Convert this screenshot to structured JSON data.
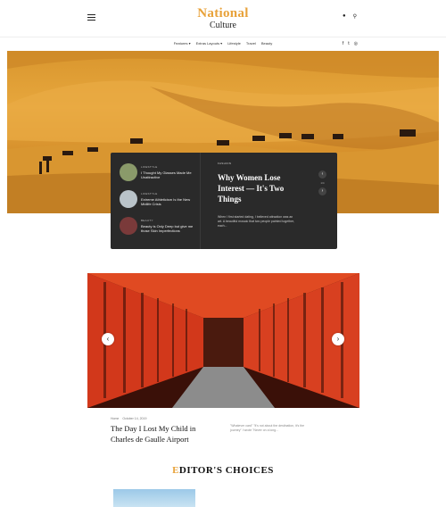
{
  "header": {
    "logo_top": "National",
    "logo_bottom": "Culture",
    "nav": [
      "Features ▾",
      "Extras Layouts ▾",
      "Lifestyle",
      "Travel",
      "Beauty"
    ],
    "user_icon": "user-icon",
    "search_icon": "search-icon",
    "social": [
      "f",
      "t",
      "◎"
    ]
  },
  "hero": {
    "side_posts": [
      {
        "category": "LIFESTYLE",
        "title": "I Thought My Glasses Made Me Unattractive"
      },
      {
        "category": "LIFESTYLE",
        "title": "Extreme Athleticism Is the New Midlife Crisis"
      },
      {
        "category": "BEAUTY",
        "title": "Beauty is Only Deep but give me those Skin Imperfections"
      }
    ],
    "featured": {
      "category": "FASHION",
      "title": "Why Women Lose Interest — It's Two Things",
      "excerpt": "When I first started dating, I believed attraction was an art. A beautiful mosaic that two people painted together, each..."
    },
    "counter": "1/4"
  },
  "post": {
    "meta_category": "Home",
    "meta_date": "October 14, 2019",
    "title": "The Day I Lost My Child in Charles de Gaulle Airport",
    "excerpt": "\"Whatever card\" \"It's not about the destination, it's the journey\" I wrote \"Never on a long..."
  },
  "editors": {
    "first_letter": "E",
    "rest": "DITOR'S CHOICES"
  }
}
